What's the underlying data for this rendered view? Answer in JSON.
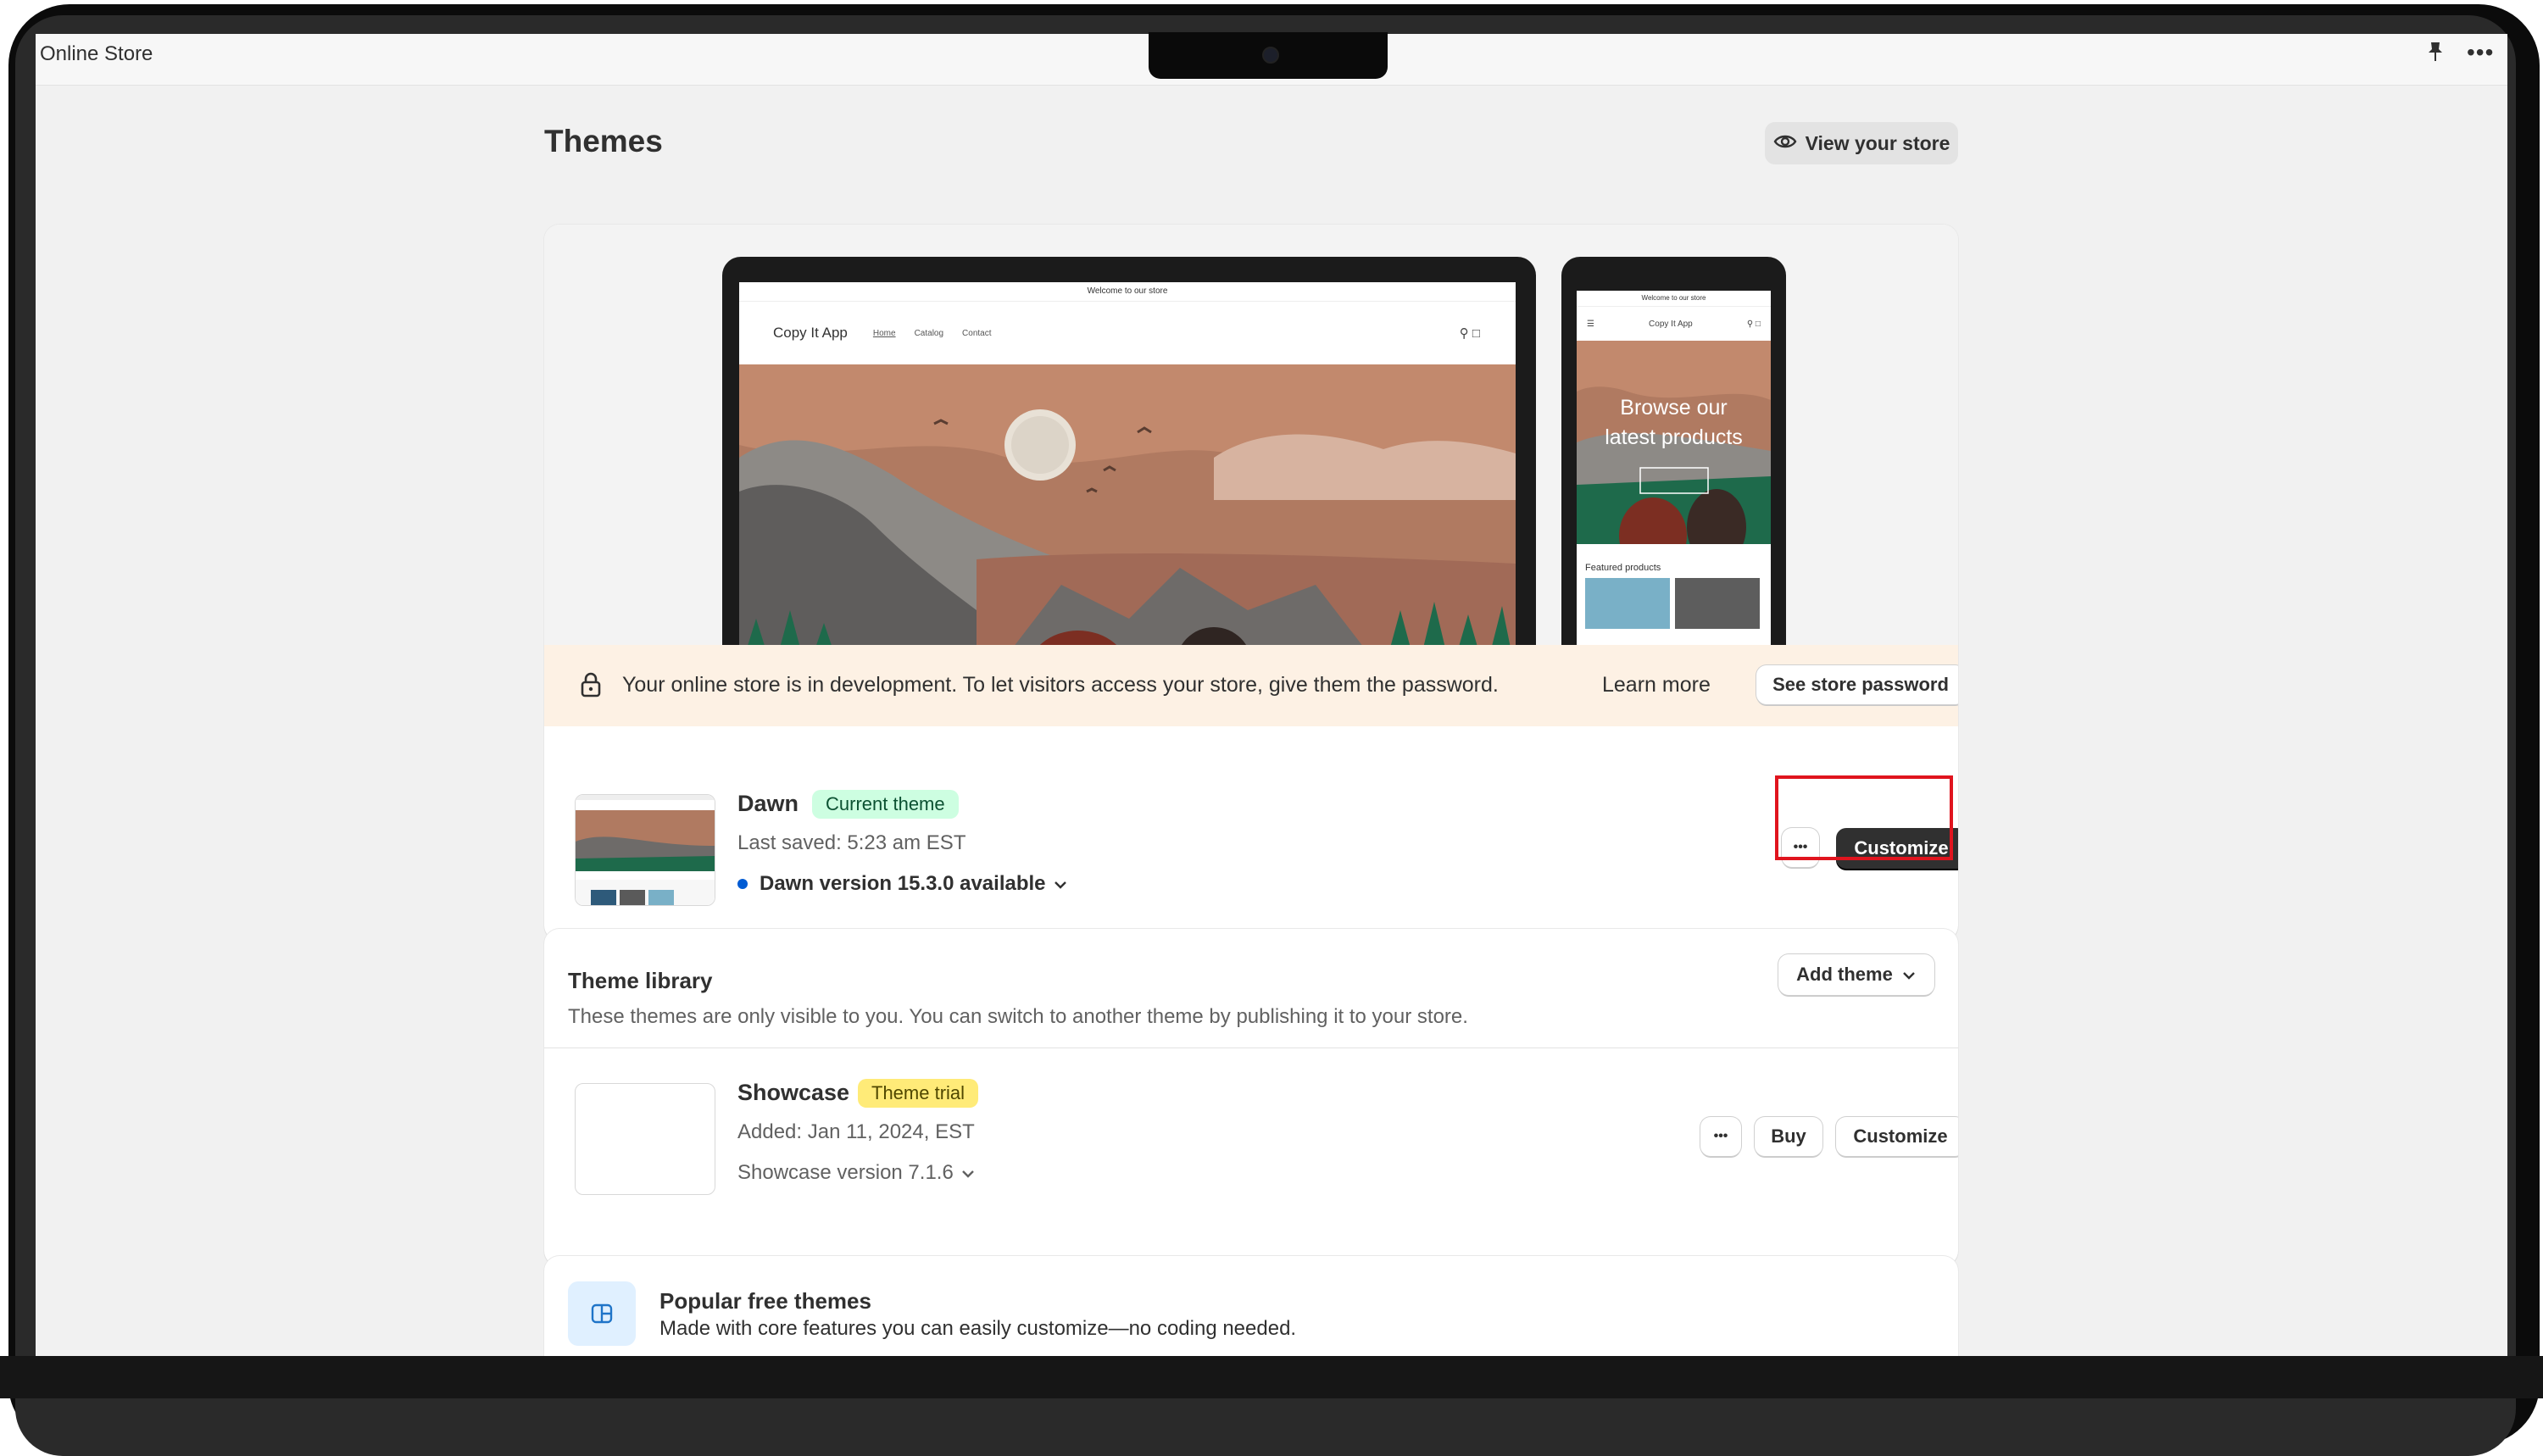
{
  "window": {
    "title": "Online Store"
  },
  "header": {
    "title": "Themes",
    "view_store_label": "View your store"
  },
  "preview": {
    "laptop": {
      "announcement": "Welcome to our store",
      "store_name": "Copy It App",
      "nav_links": [
        "Home",
        "Catalog",
        "Contact"
      ]
    },
    "phone": {
      "announcement": "Welcome to our store",
      "store_name": "Copy It App",
      "hero_text_line1": "Browse our",
      "hero_text_line2": "latest products",
      "featured_label": "Featured products"
    }
  },
  "banner": {
    "message": "Your online store is in development. To let visitors access your store, give them the password.",
    "learn_more": "Learn more",
    "password_button": "See store password"
  },
  "current_theme": {
    "name": "Dawn",
    "badge": "Current theme",
    "last_saved": "Last saved: 5:23 am EST",
    "version": "Dawn version 15.3.0 available",
    "more_label": "•••",
    "customize_label": "Customize"
  },
  "library": {
    "title": "Theme library",
    "description": "These themes are only visible to you. You can switch to another theme by publishing it to your store.",
    "add_theme_label": "Add theme",
    "themes": [
      {
        "name": "Showcase",
        "badge": "Theme trial",
        "added": "Added: Jan 11, 2024, EST",
        "version": "Showcase version 7.1.6",
        "more_label": "•••",
        "buy_label": "Buy",
        "customize_label": "Customize"
      }
    ]
  },
  "popular": {
    "title": "Popular free themes",
    "description": "Made with core features you can easily customize—no coding needed."
  },
  "colors": {
    "accent_dark": "#303030",
    "highlight_red": "#e0141e",
    "banner_bg": "#fdf1e4",
    "badge_green": "#cdfee1",
    "badge_yellow": "#ffeb78",
    "version_dot": "#005bd3"
  }
}
